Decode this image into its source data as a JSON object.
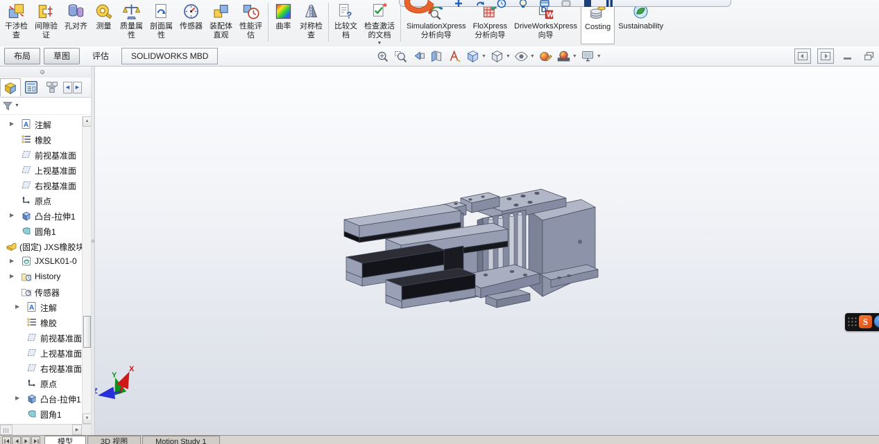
{
  "colors": {
    "logo_orange": "#e8622d",
    "accent_blue": "#2f62b5",
    "model_gray": "#9aa1b6",
    "model_pad_black": "#15161a",
    "ribbon_bg": "#f2f3f5"
  },
  "quickbar": {
    "logo": "solidworks-logo",
    "logo_letter": "S",
    "icons": [
      "plus-icon",
      "redo-icon",
      "clock-icon",
      "bulb-icon",
      "card-icon",
      "badge-20-icon",
      "window-icon",
      "pause-icon"
    ]
  },
  "ribbon": {
    "items": [
      {
        "label": "干涉检\n查",
        "icon": "interference-check"
      },
      {
        "label": "间隙验\n证",
        "icon": "clearance-verification"
      },
      {
        "label": "孔对齐",
        "icon": "hole-alignment"
      },
      {
        "label": "测量",
        "icon": "measure"
      },
      {
        "label": "质量属\n性",
        "icon": "mass-properties"
      },
      {
        "label": "剖面属\n性",
        "icon": "section-properties"
      },
      {
        "label": "传感器",
        "icon": "sensor"
      },
      {
        "label": "装配体\n直观",
        "icon": "assembly-visualization"
      },
      {
        "label": "性能评\n估",
        "icon": "performance-evaluation"
      },
      {
        "sep": true
      },
      {
        "label": "曲率",
        "icon": "curvature"
      },
      {
        "label": "对称检\n查",
        "icon": "symmetry-check"
      },
      {
        "sep": true
      },
      {
        "label": "比较文\n档",
        "icon": "compare-documents"
      },
      {
        "label": "检查激活\n的文档",
        "icon": "check-active-document",
        "dropdown": true
      },
      {
        "sep": true
      },
      {
        "label": "SimulationXpress\n分析向导",
        "icon": "simulationxpress-wizard"
      },
      {
        "label": "FloXpress\n分析向导",
        "icon": "floxpress-wizard"
      },
      {
        "label": "DriveWorksXpress\n向导",
        "icon": "driveworksxpress-wizard"
      },
      {
        "label": "Costing",
        "icon": "costing",
        "boxed": true
      },
      {
        "label": "Sustainability",
        "icon": "sustainability"
      }
    ]
  },
  "command_tabs": {
    "items": [
      {
        "label": "布局",
        "style": "btn"
      },
      {
        "label": "草图",
        "style": "btn"
      },
      {
        "label": "评估",
        "style": "active"
      },
      {
        "label": "SOLIDWORKS MBD",
        "style": "light"
      }
    ]
  },
  "hud": {
    "icons": [
      {
        "name": "zoom-to-fit-icon"
      },
      {
        "name": "zoom-to-area-icon"
      },
      {
        "name": "previous-view-icon"
      },
      {
        "name": "section-view-icon"
      },
      {
        "name": "annotation-view-icon"
      },
      {
        "name": "view-orientation-icon",
        "dropdown": true
      },
      {
        "name": "display-style-icon",
        "dropdown": true
      },
      {
        "name": "hide-show-items-icon",
        "dropdown": true
      },
      {
        "name": "edit-appearance-icon"
      },
      {
        "name": "apply-scene-icon",
        "dropdown": true
      },
      {
        "name": "view-settings-icon",
        "dropdown": true
      }
    ]
  },
  "window_controls": [
    "dock-panel-left",
    "dock-panel-right",
    "minimize-window",
    "restore-window"
  ],
  "panel": {
    "tabs": [
      {
        "name": "featuremanager-tab",
        "active": true
      },
      {
        "name": "propertymanager-tab"
      },
      {
        "name": "configurationmanager-tab"
      }
    ],
    "nav_arrows": [
      "◀",
      "▶"
    ],
    "filter": {
      "icon": "filter-funnel-icon"
    },
    "tree": [
      {
        "level": 1,
        "arrow": true,
        "icon": "annotations",
        "label": "注解"
      },
      {
        "level": 1,
        "icon": "material",
        "label": "橡胶"
      },
      {
        "level": 1,
        "icon": "plane",
        "label": "前视基准面"
      },
      {
        "level": 1,
        "icon": "plane",
        "label": "上视基准面"
      },
      {
        "level": 1,
        "icon": "plane",
        "label": "右视基准面"
      },
      {
        "level": 1,
        "icon": "origin",
        "label": "原点"
      },
      {
        "level": 1,
        "arrow": true,
        "icon": "boss-extrude",
        "label": "凸台-拉伸1"
      },
      {
        "level": 1,
        "icon": "fillet",
        "label": "圆角1"
      },
      {
        "level": 0,
        "icon": "fixed-component",
        "label": "(固定) JXS橡胶块"
      },
      {
        "level": 1,
        "arrow": true,
        "icon": "component",
        "label": "JXSLK01-0"
      },
      {
        "level": 1,
        "arrow": true,
        "icon": "history",
        "label": "History"
      },
      {
        "level": 1,
        "icon": "sensors",
        "label": "传感器"
      },
      {
        "level": 2,
        "arrow": true,
        "icon": "annotations",
        "label": "注解"
      },
      {
        "level": 2,
        "icon": "material",
        "label": "橡胶"
      },
      {
        "level": 2,
        "icon": "plane",
        "label": "前视基准面"
      },
      {
        "level": 2,
        "icon": "plane",
        "label": "上视基准面"
      },
      {
        "level": 2,
        "icon": "plane",
        "label": "右视基准面"
      },
      {
        "level": 2,
        "icon": "origin",
        "label": "原点"
      },
      {
        "level": 2,
        "arrow": true,
        "icon": "boss-extrude",
        "label": "凸台-拉伸1"
      },
      {
        "level": 2,
        "icon": "fillet",
        "label": "圆角1"
      },
      {
        "level": 0,
        "icon": "fixed-component",
        "label": ""
      }
    ]
  },
  "viewport": {
    "triad": {
      "x": "X",
      "y": "Y",
      "z": "Z"
    },
    "dock_logo_letter": "S"
  },
  "bottom_bar": {
    "nav_buttons": [
      "first-tab-button",
      "previous-tab-button",
      "next-tab-button",
      "last-tab-button"
    ],
    "tabs": [
      {
        "label": "模型",
        "active": true
      },
      {
        "label": "3D 视图"
      },
      {
        "label": "Motion Study 1"
      }
    ]
  }
}
